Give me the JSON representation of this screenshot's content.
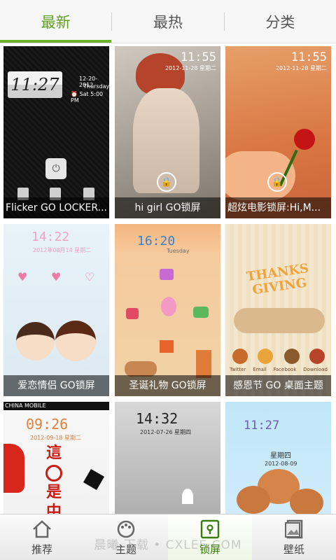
{
  "tabs": [
    {
      "label": "最新",
      "active": true
    },
    {
      "label": "最热",
      "active": false
    },
    {
      "label": "分类",
      "active": false
    }
  ],
  "accent_color": "#5f9f1c",
  "themes": [
    {
      "caption": "Flicker GO LOCKER...",
      "clock": "11:27",
      "date": "12-20-2012",
      "weekday": "Thursday",
      "alarm": "Sat 5:00 PM"
    },
    {
      "caption": "hi girl GO锁屏",
      "clock": "11:55",
      "date": "2012-11-28  星期二"
    },
    {
      "caption": "超炫电影锁屏:Hi,M...",
      "clock": "11:55",
      "date": "2012-11-28  星期二"
    },
    {
      "caption": "爱恋情侣 GO锁屏",
      "clock": "14:22",
      "date": "2012年08月14  星期二"
    },
    {
      "caption": "圣诞礼物 GO锁屏",
      "clock": "16:20",
      "date": "Tuesday"
    },
    {
      "caption": "感恩节 GO 桌面主题",
      "art_text": "THANKS GIVING",
      "dock": [
        "Twitter",
        "Email",
        "Facebook",
        "Download"
      ]
    },
    {
      "caption": "",
      "clock": "09:26",
      "date": "2012-09-18  星期二",
      "status": "CHINA MOBILE",
      "art_text": [
        "這",
        "是",
        "中"
      ]
    },
    {
      "caption": "",
      "clock": "14:32",
      "date": "2012-07-26  星期四"
    },
    {
      "caption": "",
      "clock": "11:27",
      "date": "2012-08-09",
      "weekday": "星期四"
    }
  ],
  "bottom_nav": [
    {
      "label": "推荐",
      "icon": "home-icon",
      "active": false
    },
    {
      "label": "主题",
      "icon": "palette-icon",
      "active": false
    },
    {
      "label": "锁屏",
      "icon": "lock-screen-icon",
      "active": true
    },
    {
      "label": "壁纸",
      "icon": "wallpaper-icon",
      "active": false
    }
  ],
  "watermark": "晨曦 下载 • CXLEE.COM"
}
